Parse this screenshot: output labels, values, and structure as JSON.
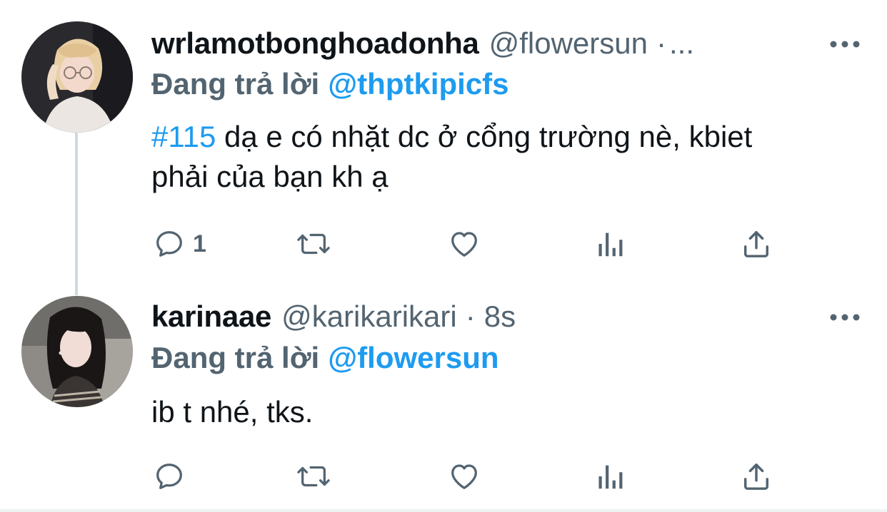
{
  "colors": {
    "text_primary": "#0f1419",
    "text_secondary": "#536471",
    "accent": "#1d9bf0",
    "thread_line": "#cfd9de"
  },
  "tweets": [
    {
      "avatar_icon": "user-avatar-photo",
      "display_name": "wrlamotbonghoadonha",
      "handle": "@flowersun",
      "separator": "·",
      "ellipsis": "...",
      "reply_prefix": "Đang trả lời",
      "reply_target": "@thptkipicfs",
      "hashtag": "#115",
      "text": " dạ e có nhặt dc ở cổng trường nè, kbiet phải của bạn kh ạ",
      "reply_count": "1",
      "actions": [
        "reply-icon",
        "retweet-icon",
        "like-icon",
        "views-icon",
        "share-icon"
      ]
    },
    {
      "avatar_icon": "user-avatar-photo",
      "display_name": "karinaae",
      "handle": "@karikarikari",
      "separator": "·",
      "time": "8s",
      "reply_prefix": "Đang trả lời",
      "reply_target": "@flowersun",
      "text": "ib t nhé, tks.",
      "actions": [
        "reply-icon",
        "retweet-icon",
        "like-icon",
        "views-icon",
        "share-icon"
      ]
    }
  ]
}
